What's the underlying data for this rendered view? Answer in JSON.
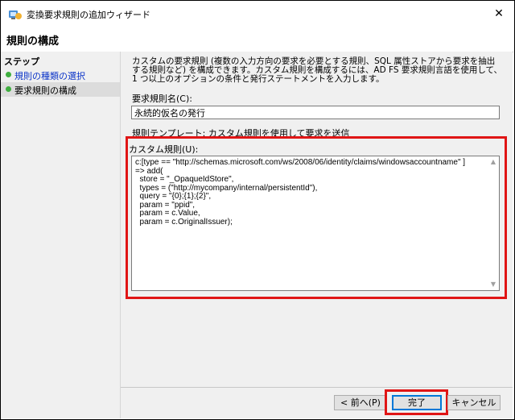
{
  "window": {
    "title": "変換要求規則の追加ウィザード",
    "close_glyph": "✕"
  },
  "header": {
    "title": "規則の構成"
  },
  "sidebar": {
    "heading": "ステップ",
    "steps": [
      {
        "label": "規則の種類の選択",
        "state": "completed"
      },
      {
        "label": "要求規則の構成",
        "state": "current"
      }
    ]
  },
  "main": {
    "description": "カスタムの要求規則 (複数の入力方向の要求を必要とする規則、SQL 属性ストアから要求を抽出する規則など) を構成できます。カスタム規則を構成するには、AD FS 要求規則言語を使用して、1 つ以上のオプションの条件と発行ステートメントを入力します。",
    "rule_name_label": "要求規則名(C):",
    "rule_name_value": "永続的仮名の発行",
    "template_label": "規則テンプレート: カスタム規則を使用して要求を送信",
    "custom_rule_label": "カスタム規則(U):",
    "custom_rule_text": "c:[type == \"http://schemas.microsoft.com/ws/2008/06/identity/claims/windowsaccountname\" ]\n=> add(\n  store = \"_OpaqueIdStore\",\n  types = (\"http://mycompany/internal/persistentId\"),\n  query = \"{0};{1};{2}\",\n  param = \"ppid\",\n  param = c.Value,\n  param = c.OriginalIssuer);"
  },
  "footer": {
    "back_label": "< 前へ(P)",
    "finish_label": "完了",
    "cancel_label": "キャンセル"
  },
  "colors": {
    "highlight": "#e01515",
    "step_dot": "#3fae3f",
    "link": "#0a33c8",
    "focus_border": "#0078d7"
  }
}
